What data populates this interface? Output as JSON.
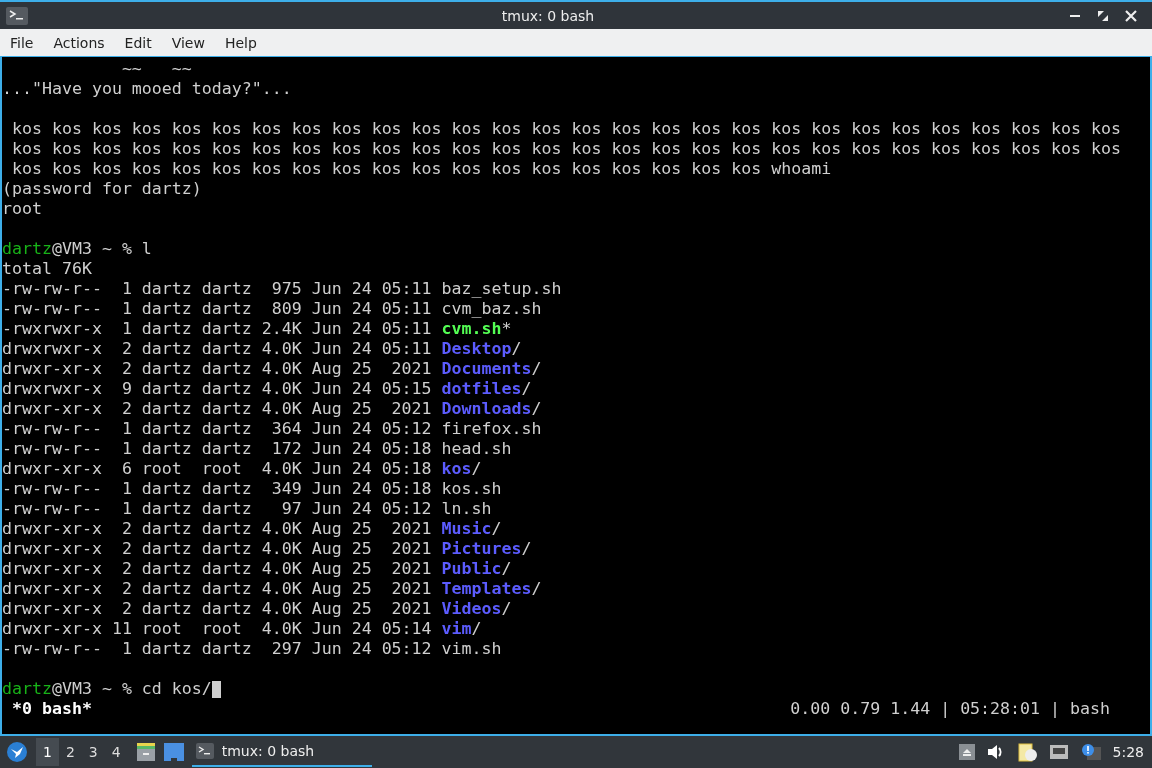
{
  "window": {
    "title": "tmux: 0 bash"
  },
  "menu": [
    "File",
    "Actions",
    "Edit",
    "View",
    "Help"
  ],
  "terminal": {
    "lines": [
      {
        "kind": "text",
        "segments": [
          {
            "text": "            ~~   ~~",
            "kind": "plain"
          }
        ]
      },
      {
        "kind": "text",
        "segments": [
          {
            "text": "...\"Have you mooed today?\"...",
            "kind": "plain"
          }
        ]
      },
      {
        "kind": "blank"
      },
      {
        "kind": "text",
        "segments": [
          {
            "text": " kos kos kos kos kos kos kos kos kos kos kos kos kos kos kos kos kos kos kos kos kos kos kos kos kos kos kos kos",
            "kind": "plain"
          }
        ]
      },
      {
        "kind": "text",
        "segments": [
          {
            "text": " kos kos kos kos kos kos kos kos kos kos kos kos kos kos kos kos kos kos kos kos kos kos kos kos kos kos kos kos",
            "kind": "plain"
          }
        ]
      },
      {
        "kind": "text",
        "segments": [
          {
            "text": " kos kos kos kos kos kos kos kos kos kos kos kos kos kos kos kos kos kos kos whoami",
            "kind": "plain"
          }
        ]
      },
      {
        "kind": "text",
        "segments": [
          {
            "text": "(password for dartz)",
            "kind": "plain"
          }
        ]
      },
      {
        "kind": "text",
        "segments": [
          {
            "text": "root",
            "kind": "plain"
          }
        ]
      },
      {
        "kind": "blank"
      },
      {
        "kind": "text",
        "segments": [
          {
            "text": "dartz",
            "kind": "user"
          },
          {
            "text": "@VM3 ~ % l",
            "kind": "plain"
          }
        ]
      },
      {
        "kind": "text",
        "segments": [
          {
            "text": "total 76K",
            "kind": "plain"
          }
        ]
      },
      {
        "kind": "text",
        "segments": [
          {
            "text": "-rw-rw-r--  1 dartz dartz  975 Jun 24 05:11 baz_setup.sh",
            "kind": "plain"
          }
        ]
      },
      {
        "kind": "text",
        "segments": [
          {
            "text": "-rw-rw-r--  1 dartz dartz  809 Jun 24 05:11 cvm_baz.sh",
            "kind": "plain"
          }
        ]
      },
      {
        "kind": "text",
        "segments": [
          {
            "text": "-rwxrwxr-x  1 dartz dartz 2.4K Jun 24 05:11 ",
            "kind": "plain"
          },
          {
            "text": "cvm.sh",
            "kind": "exe"
          },
          {
            "text": "*",
            "kind": "plain"
          }
        ]
      },
      {
        "kind": "text",
        "segments": [
          {
            "text": "drwxrwxr-x  2 dartz dartz 4.0K Jun 24 05:11 ",
            "kind": "plain"
          },
          {
            "text": "Desktop",
            "kind": "dir"
          },
          {
            "text": "/",
            "kind": "plain"
          }
        ]
      },
      {
        "kind": "text",
        "segments": [
          {
            "text": "drwxr-xr-x  2 dartz dartz 4.0K Aug 25  2021 ",
            "kind": "plain"
          },
          {
            "text": "Documents",
            "kind": "dir"
          },
          {
            "text": "/",
            "kind": "plain"
          }
        ]
      },
      {
        "kind": "text",
        "segments": [
          {
            "text": "drwxrwxr-x  9 dartz dartz 4.0K Jun 24 05:15 ",
            "kind": "plain"
          },
          {
            "text": "dotfiles",
            "kind": "dir"
          },
          {
            "text": "/",
            "kind": "plain"
          }
        ]
      },
      {
        "kind": "text",
        "segments": [
          {
            "text": "drwxr-xr-x  2 dartz dartz 4.0K Aug 25  2021 ",
            "kind": "plain"
          },
          {
            "text": "Downloads",
            "kind": "dir"
          },
          {
            "text": "/",
            "kind": "plain"
          }
        ]
      },
      {
        "kind": "text",
        "segments": [
          {
            "text": "-rw-rw-r--  1 dartz dartz  364 Jun 24 05:12 firefox.sh",
            "kind": "plain"
          }
        ]
      },
      {
        "kind": "text",
        "segments": [
          {
            "text": "-rw-rw-r--  1 dartz dartz  172 Jun 24 05:18 head.sh",
            "kind": "plain"
          }
        ]
      },
      {
        "kind": "text",
        "segments": [
          {
            "text": "drwxr-xr-x  6 root  root  4.0K Jun 24 05:18 ",
            "kind": "plain"
          },
          {
            "text": "kos",
            "kind": "dir"
          },
          {
            "text": "/",
            "kind": "plain"
          }
        ]
      },
      {
        "kind": "text",
        "segments": [
          {
            "text": "-rw-rw-r--  1 dartz dartz  349 Jun 24 05:18 kos.sh",
            "kind": "plain"
          }
        ]
      },
      {
        "kind": "text",
        "segments": [
          {
            "text": "-rw-rw-r--  1 dartz dartz   97 Jun 24 05:12 ln.sh",
            "kind": "plain"
          }
        ]
      },
      {
        "kind": "text",
        "segments": [
          {
            "text": "drwxr-xr-x  2 dartz dartz 4.0K Aug 25  2021 ",
            "kind": "plain"
          },
          {
            "text": "Music",
            "kind": "dir"
          },
          {
            "text": "/",
            "kind": "plain"
          }
        ]
      },
      {
        "kind": "text",
        "segments": [
          {
            "text": "drwxr-xr-x  2 dartz dartz 4.0K Aug 25  2021 ",
            "kind": "plain"
          },
          {
            "text": "Pictures",
            "kind": "dir"
          },
          {
            "text": "/",
            "kind": "plain"
          }
        ]
      },
      {
        "kind": "text",
        "segments": [
          {
            "text": "drwxr-xr-x  2 dartz dartz 4.0K Aug 25  2021 ",
            "kind": "plain"
          },
          {
            "text": "Public",
            "kind": "dir"
          },
          {
            "text": "/",
            "kind": "plain"
          }
        ]
      },
      {
        "kind": "text",
        "segments": [
          {
            "text": "drwxr-xr-x  2 dartz dartz 4.0K Aug 25  2021 ",
            "kind": "plain"
          },
          {
            "text": "Templates",
            "kind": "dir"
          },
          {
            "text": "/",
            "kind": "plain"
          }
        ]
      },
      {
        "kind": "text",
        "segments": [
          {
            "text": "drwxr-xr-x  2 dartz dartz 4.0K Aug 25  2021 ",
            "kind": "plain"
          },
          {
            "text": "Videos",
            "kind": "dir"
          },
          {
            "text": "/",
            "kind": "plain"
          }
        ]
      },
      {
        "kind": "text",
        "segments": [
          {
            "text": "drwxr-xr-x 11 root  root  4.0K Jun 24 05:14 ",
            "kind": "plain"
          },
          {
            "text": "vim",
            "kind": "dir"
          },
          {
            "text": "/",
            "kind": "plain"
          }
        ]
      },
      {
        "kind": "text",
        "segments": [
          {
            "text": "-rw-rw-r--  1 dartz dartz  297 Jun 24 05:12 vim.sh",
            "kind": "plain"
          }
        ]
      },
      {
        "kind": "blank"
      },
      {
        "kind": "prompt",
        "segments": [
          {
            "text": "dartz",
            "kind": "user"
          },
          {
            "text": "@VM3 ~ % cd kos/",
            "kind": "plain"
          }
        ]
      }
    ],
    "status_bar": {
      "left": " *0 bash*",
      "right": "0.00 0.79 1.44 | 05:28:01 | bash"
    }
  },
  "taskbar": {
    "workspaces": [
      {
        "label": "1",
        "selected": true
      },
      {
        "label": "2",
        "selected": false
      },
      {
        "label": "3",
        "selected": false
      },
      {
        "label": "4",
        "selected": false
      }
    ],
    "tasks": [
      {
        "title": "tmux: 0 bash",
        "selected": true
      }
    ],
    "clock": "5:28"
  }
}
